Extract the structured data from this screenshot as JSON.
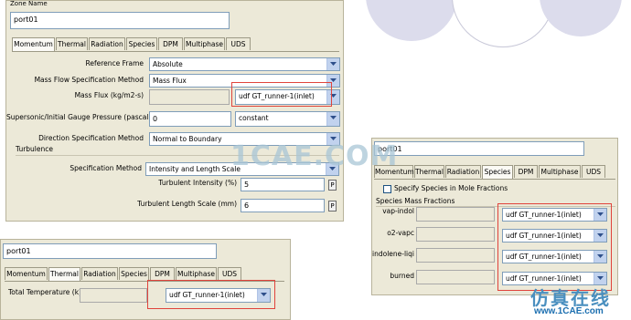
{
  "top_panel": {
    "zone_name_label": "Zone Name",
    "zone_name_value": "port01",
    "tabs": [
      "Momentum",
      "Thermal",
      "Radiation",
      "Species",
      "DPM",
      "Multiphase",
      "UDS"
    ],
    "fields": {
      "reference_frame_label": "Reference Frame",
      "reference_frame_value": "Absolute",
      "mass_flow_spec_label": "Mass Flow Specification Method",
      "mass_flow_spec_value": "Mass Flux",
      "mass_flux_label": "Mass Flux (kg/m2-s)",
      "mass_flux_profile": "udf GT_runner-1(inlet)",
      "gauge_pressure_label": "Supersonic/Initial Gauge Pressure (pascal)",
      "gauge_pressure_value": "0",
      "gauge_pressure_profile": "constant",
      "direction_spec_label": "Direction Specification Method",
      "direction_spec_value": "Normal to Boundary",
      "turbulence_label": "Turbulence",
      "turb_spec_label": "Specification Method",
      "turb_spec_value": "Intensity and Length Scale",
      "turb_intensity_label": "Turbulent Intensity (%)",
      "turb_intensity_value": "5",
      "turb_length_label": "Turbulent Length Scale (mm)",
      "turb_length_value": "6",
      "param_button": "P"
    }
  },
  "bottom_left_panel": {
    "zone_name_value": "port01",
    "tabs": [
      "Momentum",
      "Thermal",
      "Radiation",
      "Species",
      "DPM",
      "Multiphase",
      "UDS"
    ],
    "total_temp_label": "Total Temperature (k)",
    "total_temp_profile": "udf GT_runner-1(inlet)"
  },
  "right_panel": {
    "zone_name_value": "port01",
    "tabs": [
      "Momentum",
      "Thermal",
      "Radiation",
      "Species",
      "DPM",
      "Multiphase",
      "UDS"
    ],
    "specify_mole_label": "Specify Species in Mole Fractions",
    "species_mass_fractions_label": "Species Mass Fractions",
    "species": [
      {
        "name": "vap-indol",
        "profile": "udf GT_runner-1(inlet)"
      },
      {
        "name": "o2-vapc",
        "profile": "udf GT_runner-1(inlet)"
      },
      {
        "name": "indolene-liqi",
        "profile": "udf GT_runner-1(inlet)"
      },
      {
        "name": "burned",
        "profile": "udf GT_runner-1(inlet)"
      }
    ]
  },
  "watermark": {
    "text": "1CAE.COM",
    "logo_cn": "仿真在线",
    "site": "www.1CAE.com"
  },
  "colors": {
    "panel_bg": "#ece9d8",
    "highlight_red": "#e0443c",
    "dropdown_arrow_bg": "#c1d2ee",
    "decor_circle": "#d9d9ec"
  }
}
